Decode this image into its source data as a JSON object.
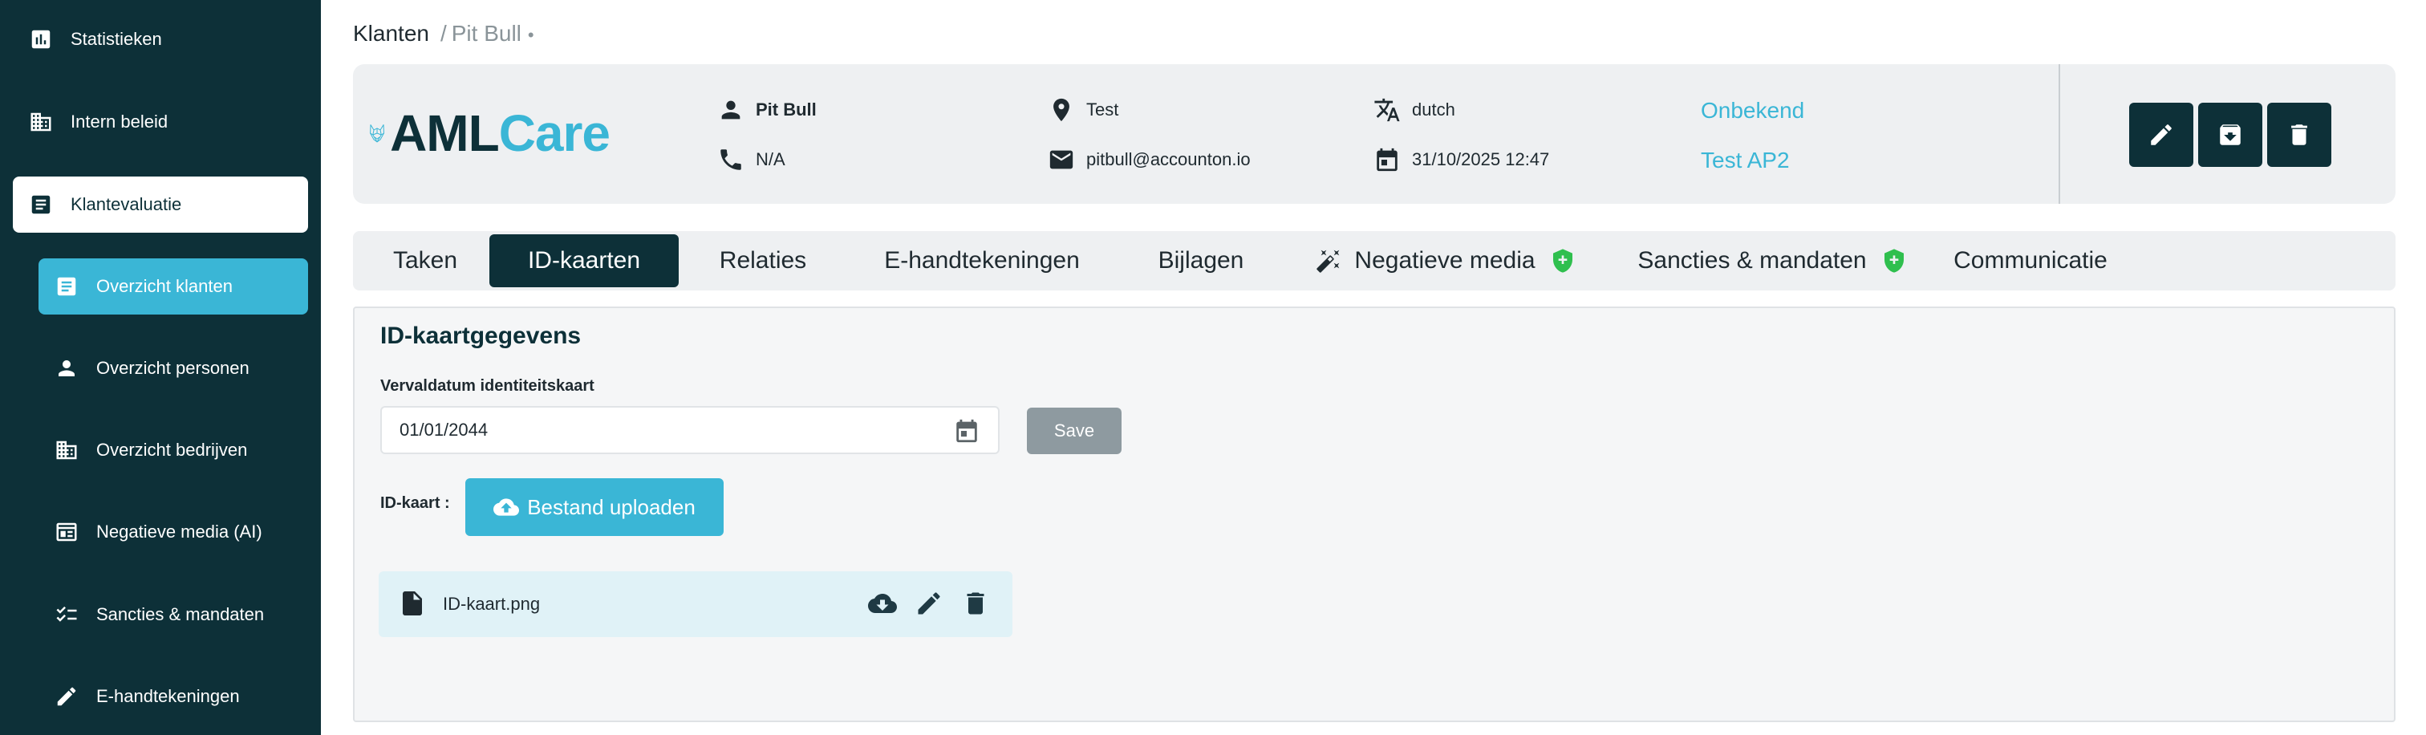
{
  "sidebar": {
    "items": [
      {
        "label": "Statistieken",
        "icon": "bar-chart-icon"
      },
      {
        "label": "Intern beleid",
        "icon": "building-icon"
      },
      {
        "label": "Klantevaluatie",
        "icon": "document-icon"
      },
      {
        "label": "Overzicht klanten",
        "icon": "list-document-icon"
      },
      {
        "label": "Overzicht personen",
        "icon": "person-icon"
      },
      {
        "label": "Overzicht bedrijven",
        "icon": "building-icon"
      },
      {
        "label": "Negatieve media (AI)",
        "icon": "newspaper-icon"
      },
      {
        "label": "Sancties & mandaten",
        "icon": "checklist-icon"
      },
      {
        "label": "E-handtekeningen",
        "icon": "pencil-icon"
      }
    ]
  },
  "breadcrumb": {
    "root": "Klanten",
    "separator": "/",
    "current": "Pit Bull",
    "dot": "•"
  },
  "logo": {
    "part1": "AML",
    "part2": "Care",
    "color_dark": "#0d3038",
    "color_accent": "#3ab6d6"
  },
  "client": {
    "name": "Pit Bull",
    "phone": "N/A",
    "location": "Test",
    "email": "pitbull@accounton.io",
    "language": "dutch",
    "date": "31/10/2025 12:47",
    "status": "Onbekend",
    "assignee": "Test AP2"
  },
  "actions": {
    "edit": "edit-icon",
    "archive": "archive-icon",
    "delete": "trash-icon"
  },
  "tabs": [
    {
      "label": "Taken"
    },
    {
      "label": "ID-kaarten",
      "active": true
    },
    {
      "label": "Relaties"
    },
    {
      "label": "E-handtekeningen"
    },
    {
      "label": "Bijlagen"
    },
    {
      "label": "Negatieve media"
    },
    {
      "label": "Sancties & mandaten"
    },
    {
      "label": "Communicatie"
    }
  ],
  "panel": {
    "title": "ID-kaartgegevens",
    "expiry_label": "Vervaldatum identiteitskaart",
    "expiry_value": "01/01/2044",
    "save_label": "Save",
    "id_label": "ID-kaart :",
    "upload_label": "Bestand uploaden",
    "file_name": "ID-kaart.png"
  },
  "colors": {
    "sidebar": "#0d3038",
    "accent": "#3ab6d6",
    "shield": "#2fbf4e",
    "save_disabled": "#8e9aa0"
  }
}
